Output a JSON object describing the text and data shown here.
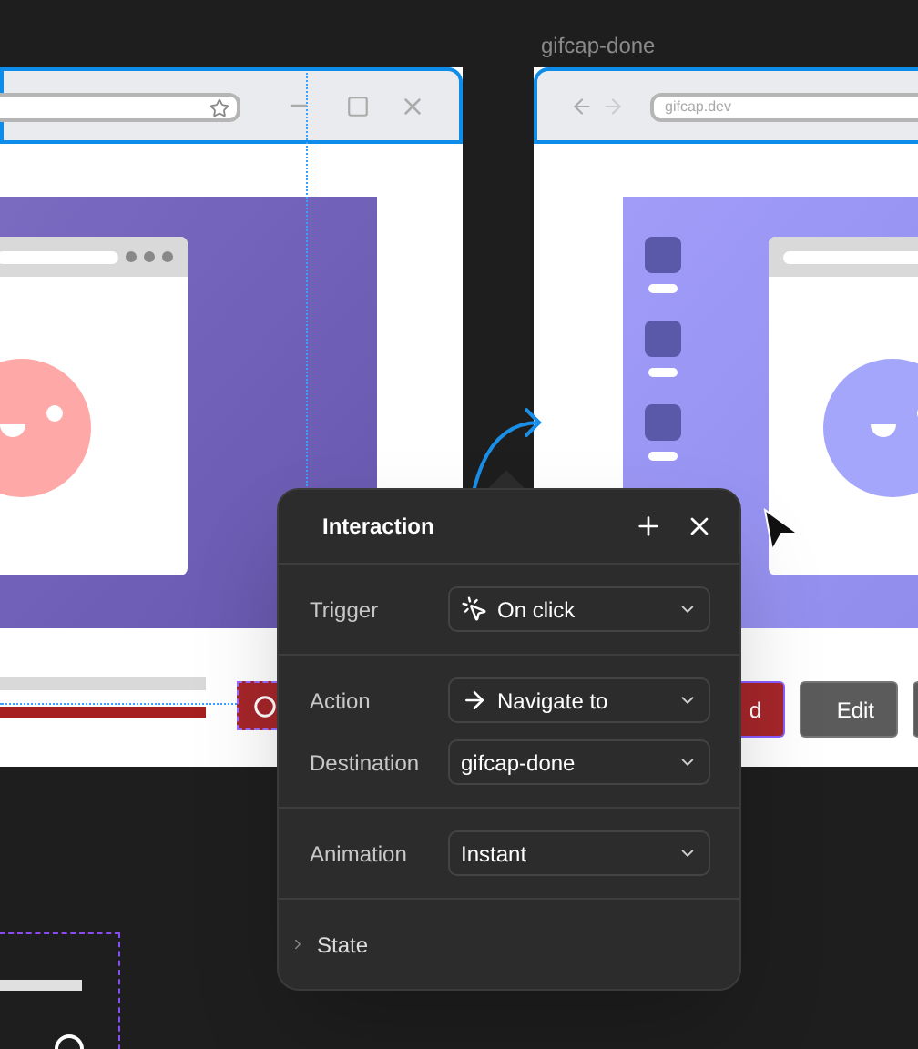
{
  "frames": [
    {
      "selected": true
    },
    {
      "title": "gifcap-done",
      "url": "gifcap.dev",
      "selected": true
    }
  ],
  "buttons": [
    {
      "label": "d",
      "kind": "danger"
    },
    {
      "label": "Edit",
      "kind": "neutral"
    }
  ],
  "panel": {
    "title": "Interaction",
    "sections": [
      [
        {
          "label": "Trigger",
          "value": "On click",
          "kind": "click"
        }
      ],
      [
        {
          "label": "Action",
          "value": "Navigate to",
          "kind": "arrow"
        },
        {
          "label": "Destination",
          "value": "gifcap-done"
        }
      ],
      [
        {
          "label": "Animation",
          "value": "Instant"
        }
      ]
    ],
    "state": {
      "label": "State",
      "expanded": false
    }
  }
}
